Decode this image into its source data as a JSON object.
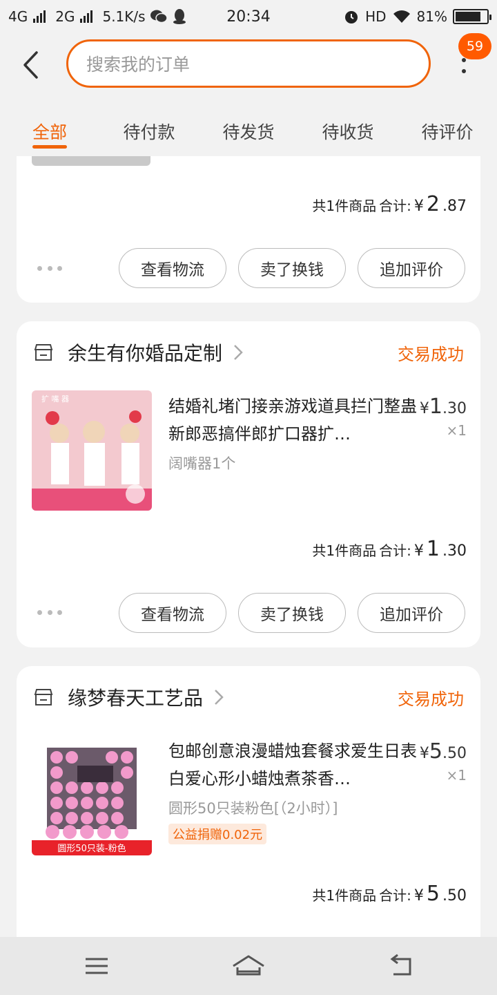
{
  "statusbar": {
    "net1": "4G",
    "net2": "2G",
    "speed": "5.1K/s",
    "time": "20:34",
    "hd": "HD",
    "battery_percent": "81%",
    "battery_level": 0.81
  },
  "header": {
    "search_placeholder": "搜索我的订单",
    "badge_count": "59"
  },
  "tabs": [
    {
      "label": "全部"
    },
    {
      "label": "待付款"
    },
    {
      "label": "待发货"
    },
    {
      "label": "待收货"
    },
    {
      "label": "待评价"
    }
  ],
  "orders": [
    {
      "total": {
        "count_text": "共1件商品",
        "sum_label": "合计:",
        "currency": "¥",
        "int": "2",
        "dec": ".87"
      },
      "buttons": [
        "查看物流",
        "卖了换钱",
        "追加评价"
      ]
    },
    {
      "shop": "余生有你婚品定制",
      "status": "交易成功",
      "product": {
        "title": "结婚礼堵门接亲游戏道具拦门整蛊新郎恶搞伴郎扩口器扩…",
        "sku": "阔嘴器1个",
        "img_caption": "扩 嘴 器",
        "price_currency": "¥",
        "price_int": "1",
        "price_dec": ".30",
        "qty": "×1"
      },
      "total": {
        "count_text": "共1件商品",
        "sum_label": "合计:",
        "currency": "¥",
        "int": "1",
        "dec": ".30"
      },
      "buttons": [
        "查看物流",
        "卖了换钱",
        "追加评价"
      ]
    },
    {
      "shop": "缘梦春天工艺品",
      "status": "交易成功",
      "product": {
        "title": "包邮创意浪漫蜡烛套餐求爱生日表白爱心形小蜡烛煮茶香…",
        "sku": "圆形50只装粉色[（2小时）]",
        "tag": "公益捐赠0.02元",
        "img_caption": "圆形50只装-粉色",
        "price_currency": "¥",
        "price_int": "5",
        "price_dec": ".50",
        "qty": "×1"
      },
      "total": {
        "count_text": "共1件商品",
        "sum_label": "合计:",
        "currency": "¥",
        "int": "5",
        "dec": ".50"
      }
    }
  ]
}
